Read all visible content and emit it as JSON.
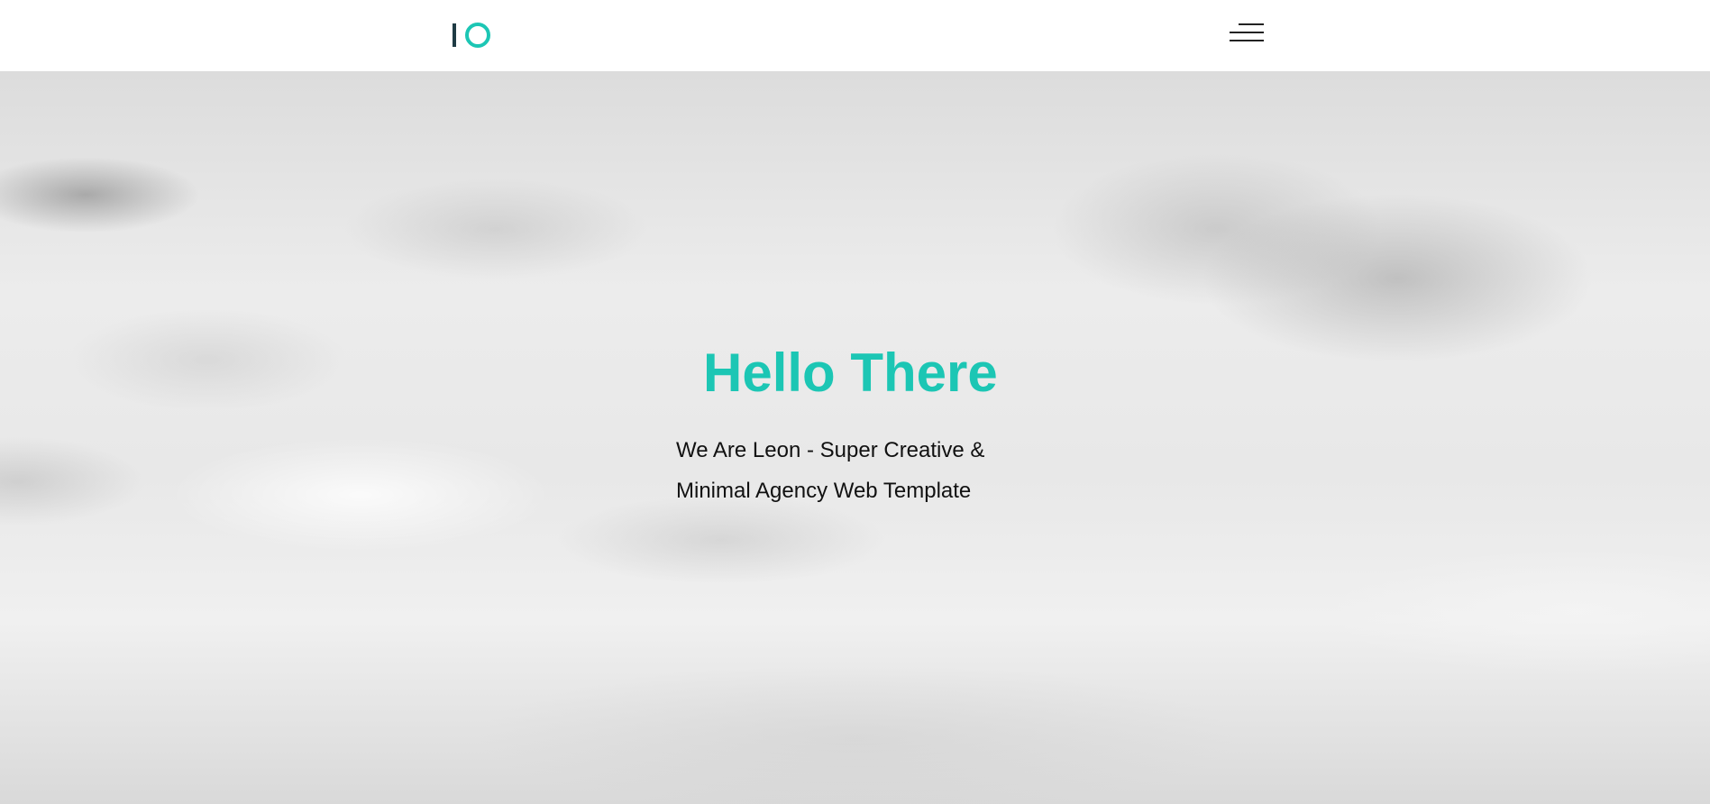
{
  "colors": {
    "accent": "#1cc6b4",
    "logo_dark": "#1f3b44",
    "text": "#111111",
    "header_bg": "#ffffff"
  },
  "header": {
    "logo": {
      "icon": "leon-logo-icon"
    },
    "menu": {
      "icon": "hamburger-menu-icon"
    }
  },
  "hero": {
    "background_icon": "cloudy-sky-background",
    "title": "Hello There",
    "subtitle_line1": "We Are Leon - Super Creative &",
    "subtitle_line2": "Minimal Agency Web Template"
  }
}
